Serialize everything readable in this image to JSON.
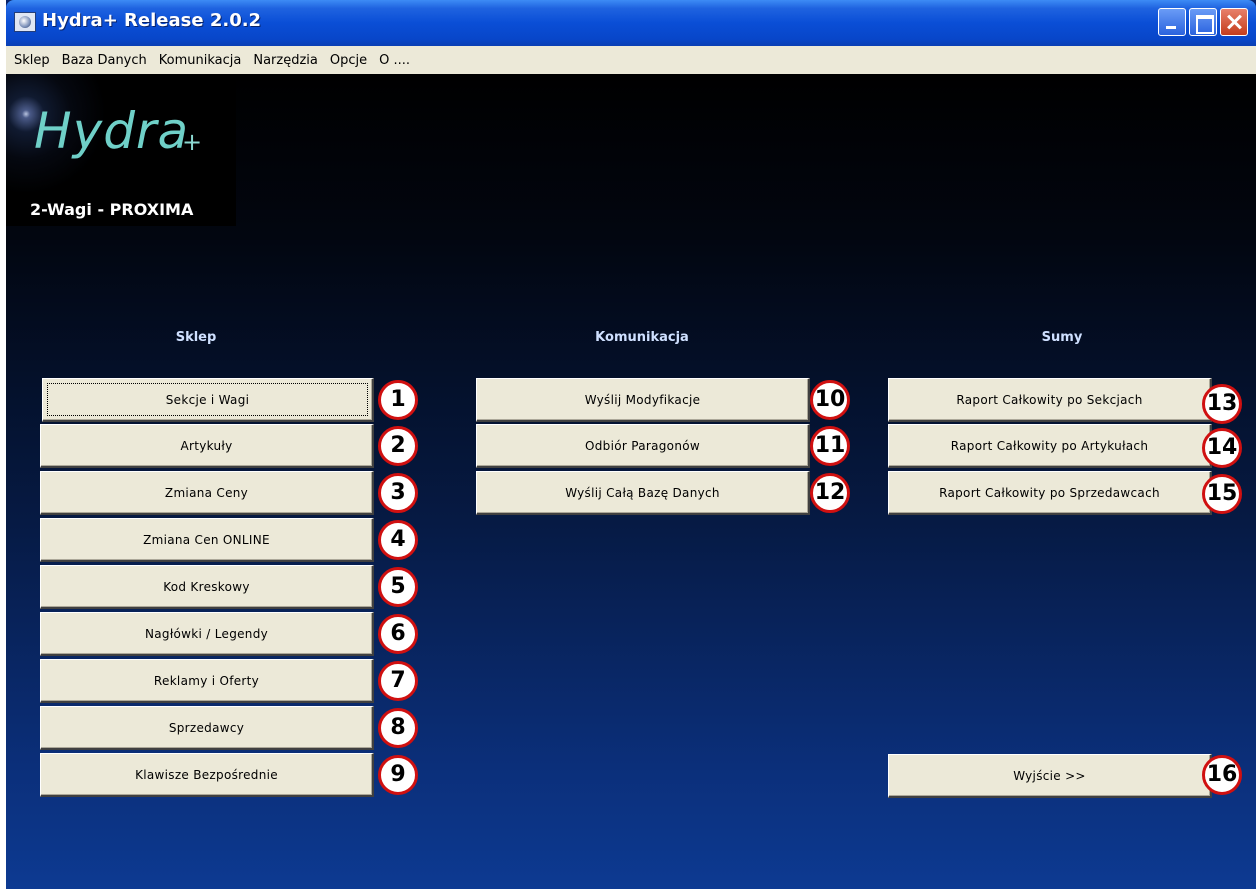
{
  "window": {
    "title": "Hydra+ Release 2.0.2"
  },
  "menu": [
    "Sklep",
    "Baza Danych",
    "Komunikacja",
    "Narzędzia",
    "Opcje",
    "O ...."
  ],
  "logo": {
    "text": "Hydra",
    "plus": "+",
    "subtitle": "2-Wagi - PROXIMA"
  },
  "columns": {
    "sklep": {
      "header": "Sklep",
      "buttons": [
        {
          "label": "Sekcje i Wagi",
          "badge": "1"
        },
        {
          "label": "Artykuły",
          "badge": "2"
        },
        {
          "label": "Zmiana Ceny",
          "badge": "3"
        },
        {
          "label": "Zmiana Cen ONLINE",
          "badge": "4"
        },
        {
          "label": "Kod Kreskowy",
          "badge": "5"
        },
        {
          "label": "Nagłówki / Legendy",
          "badge": "6"
        },
        {
          "label": "Reklamy i Oferty",
          "badge": "7"
        },
        {
          "label": "Sprzedawcy",
          "badge": "8"
        },
        {
          "label": "Klawisze Bezpośrednie",
          "badge": "9"
        }
      ]
    },
    "komunikacja": {
      "header": "Komunikacja",
      "buttons": [
        {
          "label": "Wyślij Modyfikacje",
          "badge": "10"
        },
        {
          "label": "Odbiór Paragonów",
          "badge": "11"
        },
        {
          "label": "Wyślij Całą Bazę Danych",
          "badge": "12"
        }
      ]
    },
    "sumy": {
      "header": "Sumy",
      "buttons": [
        {
          "label": "Raport Całkowity po Sekcjach",
          "badge": "13"
        },
        {
          "label": "Raport Całkowity po Artykułach",
          "badge": "14"
        },
        {
          "label": "Raport Całkowity po Sprzedawcach",
          "badge": "15"
        }
      ]
    }
  },
  "exit": {
    "label": "Wyjście >>",
    "badge": "16"
  },
  "colors": {
    "titlebar": "#0a4ed6",
    "menubar": "#ece9d8",
    "button_face": "#ece9d8",
    "badge_ring": "#d01010",
    "header_text": "#cfe0ff",
    "logo_text": "#6fd0c8"
  }
}
